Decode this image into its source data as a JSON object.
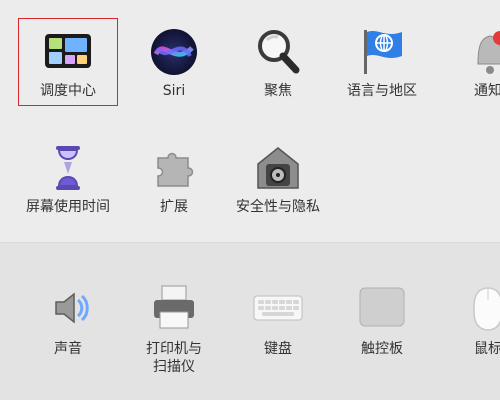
{
  "window": {
    "title": ""
  },
  "selected_pane": "mission-control",
  "top_row": [
    {
      "id": "mission-control",
      "label": "调度中心",
      "icon": "mission-control-icon"
    },
    {
      "id": "siri",
      "label": "Siri",
      "icon": "siri-icon"
    },
    {
      "id": "spotlight",
      "label": "聚焦",
      "icon": "spotlight-magnifier-icon"
    },
    {
      "id": "language-region",
      "label": "语言与地区",
      "icon": "globe-flag-icon"
    },
    {
      "id": "notifications",
      "label": "通知",
      "icon": "notification-bell-icon"
    }
  ],
  "second_row": [
    {
      "id": "screen-time",
      "label": "屏幕使用时间",
      "icon": "hourglass-icon"
    },
    {
      "id": "extensions",
      "label": "扩展",
      "icon": "puzzle-piece-icon"
    },
    {
      "id": "security-privacy",
      "label": "安全性与隐私",
      "icon": "house-safe-icon"
    }
  ],
  "hardware_row": [
    {
      "id": "sound",
      "label": "声音",
      "icon": "speaker-icon"
    },
    {
      "id": "printers-scanners",
      "label_line1": "打印机与",
      "label_line2": "扫描仪",
      "icon": "printer-icon"
    },
    {
      "id": "keyboard",
      "label": "键盘",
      "icon": "keyboard-icon"
    },
    {
      "id": "trackpad",
      "label": "触控板",
      "icon": "trackpad-icon"
    },
    {
      "id": "mouse",
      "label": "鼠标",
      "icon": "mouse-icon"
    }
  ],
  "colors": {
    "selection_border": "#d9262c",
    "background": "#ececec",
    "hardware_background": "#e3e3e3"
  }
}
